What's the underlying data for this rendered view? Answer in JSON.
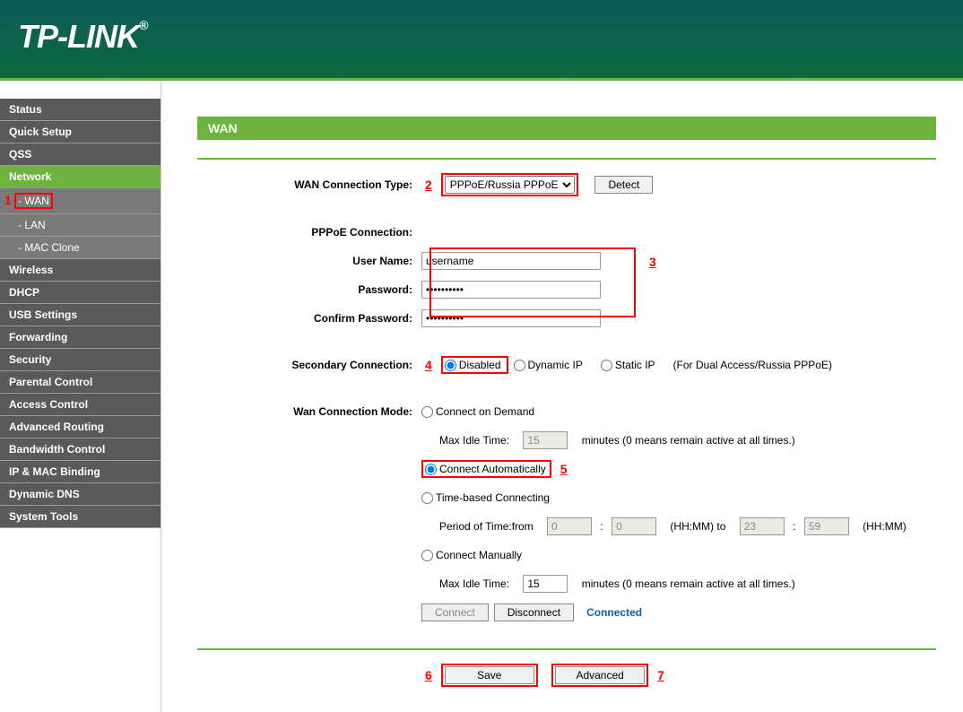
{
  "logo": "TP-LINK",
  "sidebar": {
    "items": [
      {
        "label": "Status",
        "active": false
      },
      {
        "label": "Quick Setup",
        "active": false
      },
      {
        "label": "QSS",
        "active": false
      },
      {
        "label": "Network",
        "active": true
      },
      {
        "label": "Wireless",
        "active": false
      },
      {
        "label": "DHCP",
        "active": false
      },
      {
        "label": "USB Settings",
        "active": false
      },
      {
        "label": "Forwarding",
        "active": false
      },
      {
        "label": "Security",
        "active": false
      },
      {
        "label": "Parental Control",
        "active": false
      },
      {
        "label": "Access Control",
        "active": false
      },
      {
        "label": "Advanced Routing",
        "active": false
      },
      {
        "label": "Bandwidth Control",
        "active": false
      },
      {
        "label": "IP & MAC Binding",
        "active": false
      },
      {
        "label": "Dynamic DNS",
        "active": false
      },
      {
        "label": "System Tools",
        "active": false
      }
    ],
    "network_sub": [
      {
        "label": "- WAN",
        "active": true
      },
      {
        "label": "- LAN",
        "active": false
      },
      {
        "label": "- MAC Clone",
        "active": false
      }
    ]
  },
  "page": {
    "title": "WAN",
    "labels": {
      "conn_type": "WAN Connection Type:",
      "pppoe_conn": "PPPoE Connection:",
      "username": "User Name:",
      "password": "Password:",
      "confirm_password": "Confirm Password:",
      "secondary_conn": "Secondary Connection:",
      "wan_mode": "Wan Connection Mode:",
      "max_idle": "Max Idle Time:",
      "period_from": "Period of Time:from",
      "minutes_hint": "minutes (0 means remain active at all times.)",
      "hhmm_to": "(HH:MM) to",
      "hhmm": "(HH:MM)",
      "dual_hint": "(For Dual Access/Russia PPPoE)"
    },
    "values": {
      "conn_type": "PPPoE/Russia PPPoE",
      "username": "username",
      "password": "••••••••••",
      "confirm_password": "••••••••••",
      "max_idle1": "15",
      "max_idle2": "15",
      "time_from_h": "0",
      "time_from_m": "0",
      "time_to_h": "23",
      "time_to_m": "59",
      "status": "Connected"
    },
    "radios": {
      "disabled": "Disabled",
      "dynamic_ip": "Dynamic IP",
      "static_ip": "Static IP",
      "connect_demand": "Connect on Demand",
      "connect_auto": "Connect Automatically",
      "time_based": "Time-based Connecting",
      "connect_manual": "Connect Manually"
    },
    "buttons": {
      "detect": "Detect",
      "connect": "Connect",
      "disconnect": "Disconnect",
      "save": "Save",
      "advanced": "Advanced"
    }
  },
  "markers": {
    "m1": "1",
    "m2": "2",
    "m3": "3",
    "m4": "4",
    "m5": "5",
    "m6": "6",
    "m7": "7"
  }
}
